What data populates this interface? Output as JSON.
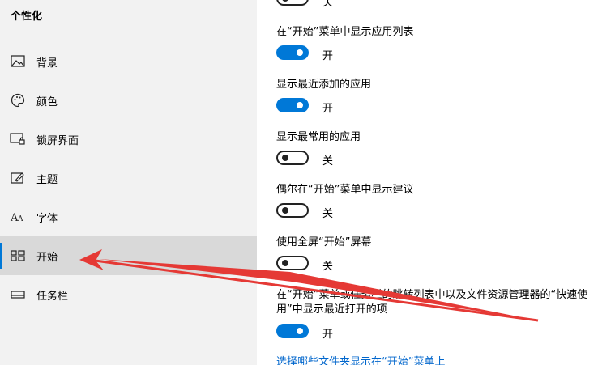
{
  "sidebar": {
    "title": "个性化",
    "items": [
      {
        "label": "背景",
        "icon": "picture-icon"
      },
      {
        "label": "颜色",
        "icon": "palette-icon"
      },
      {
        "label": "锁屏界面",
        "icon": "lock-screen-icon"
      },
      {
        "label": "主题",
        "icon": "theme-brush-icon"
      },
      {
        "label": "字体",
        "icon": "font-icon"
      },
      {
        "label": "开始",
        "icon": "start-tiles-icon",
        "selected": true
      },
      {
        "label": "任务栏",
        "icon": "taskbar-icon"
      }
    ]
  },
  "main": {
    "top_toggle_state": "关",
    "settings": [
      {
        "label": "在“开始”菜单中显示应用列表",
        "on": true,
        "state": "开"
      },
      {
        "label": "显示最近添加的应用",
        "on": true,
        "state": "开"
      },
      {
        "label": "显示最常用的应用",
        "on": false,
        "state": "关"
      },
      {
        "label": "偶尔在“开始”菜单中显示建议",
        "on": false,
        "state": "关"
      },
      {
        "label": "使用全屏“开始”屏幕",
        "on": false,
        "state": "关"
      },
      {
        "label_line1": "在“开始”菜单或任务栏的跳转列表中以及文件资源管理器的“快速使",
        "label_line2": "用”中显示最近打开的项",
        "on": true,
        "state": "开"
      }
    ],
    "link": "选择哪些文件夹显示在“开始”菜单上"
  },
  "colors": {
    "accent": "#0078d7",
    "annotation_arrow": "#e53935",
    "link": "#0066cc"
  }
}
